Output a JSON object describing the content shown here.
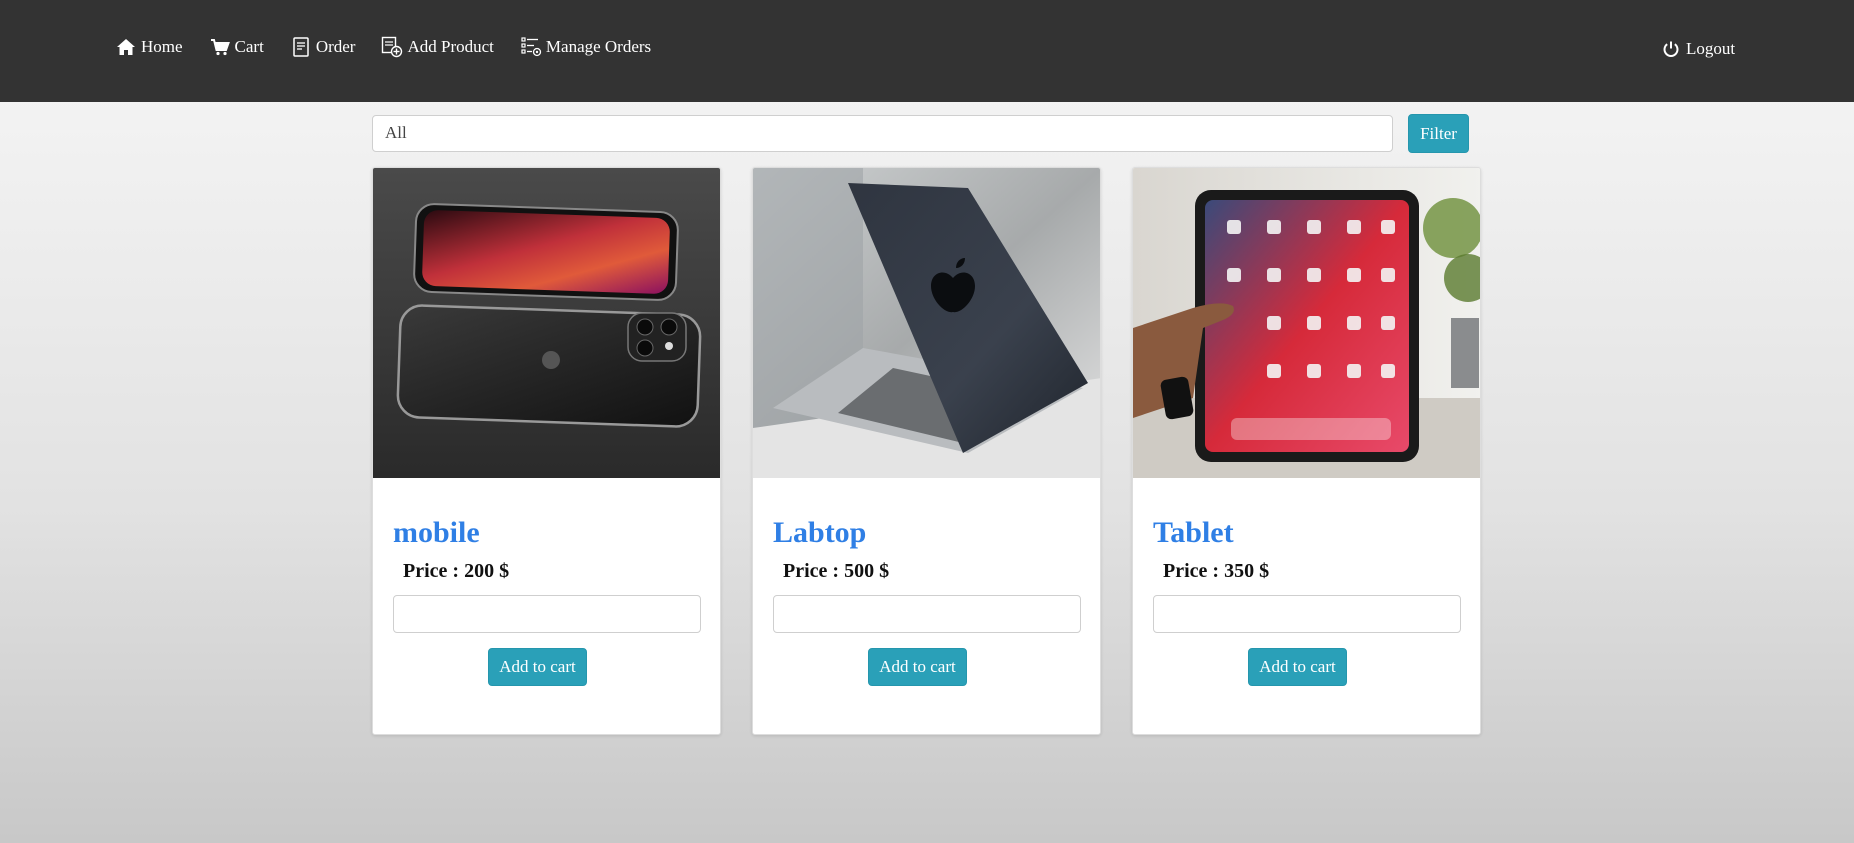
{
  "nav": {
    "items": [
      {
        "label": "Home",
        "icon": "home-icon"
      },
      {
        "label": "Cart",
        "icon": "cart-icon"
      },
      {
        "label": "Order",
        "icon": "order-icon"
      },
      {
        "label": "Add Product",
        "icon": "add-product-icon"
      },
      {
        "label": "Manage Orders",
        "icon": "manage-orders-icon"
      }
    ],
    "logout": {
      "label": "Logout",
      "icon": "power-icon"
    }
  },
  "filter": {
    "selected": "All",
    "button_label": "Filter"
  },
  "products": [
    {
      "name": "mobile",
      "price": "Price : 200 $",
      "button_label": "Add to cart",
      "image": "smartphones-photo"
    },
    {
      "name": "Labtop",
      "price": "Price : 500 $",
      "button_label": "Add to cart",
      "image": "laptop-photo"
    },
    {
      "name": "Tablet",
      "price": "Price : 350 $",
      "button_label": "Add to cart",
      "image": "tablet-photo"
    }
  ],
  "colors": {
    "navbar": "#333333",
    "accent_button": "#2aa0b8",
    "product_name": "#2f7fe5"
  }
}
